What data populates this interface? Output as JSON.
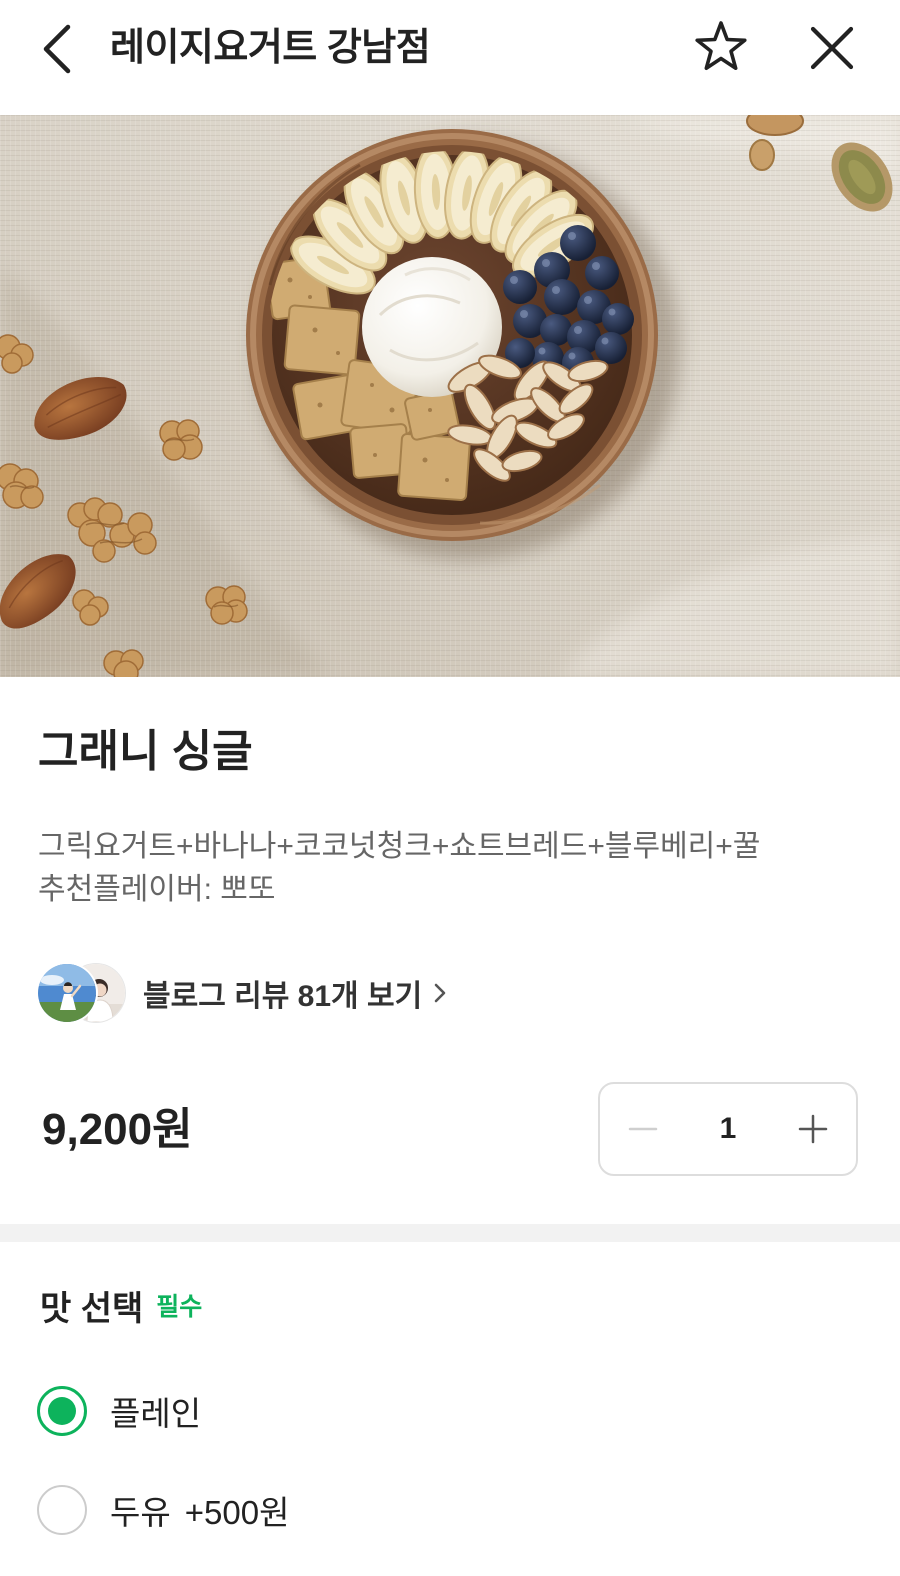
{
  "header": {
    "title": "레이지요거트 강남점",
    "back_icon": "chevron-left-icon",
    "favorite_icon": "star-icon",
    "close_icon": "close-icon"
  },
  "product": {
    "name": "그래니 싱글",
    "description": [
      "그릭요거트+바나나+코코넛청크+쇼트브레드+블루베리+꿀",
      "추천플레이버: 뽀또"
    ],
    "blog_review_link": "블로그 리뷰 81개 보기",
    "blog_review_icon": "chevron-right-icon",
    "price": "9,200원"
  },
  "quantity": {
    "value": "1",
    "decrement_icon": "minus-icon",
    "increment_icon": "plus-icon",
    "decrement_enabled": false
  },
  "option_group": {
    "title": "맛 선택",
    "required_badge": "필수",
    "options": [
      {
        "label": "플레인",
        "selected": true
      },
      {
        "label": "두유",
        "extra_price": "+500원",
        "selected": false
      }
    ]
  },
  "colors": {
    "accent": "#0db35c",
    "text_primary": "#222222",
    "text_secondary": "#666666",
    "divider": "#f2f2f2",
    "stepper_border": "#dddddd"
  }
}
